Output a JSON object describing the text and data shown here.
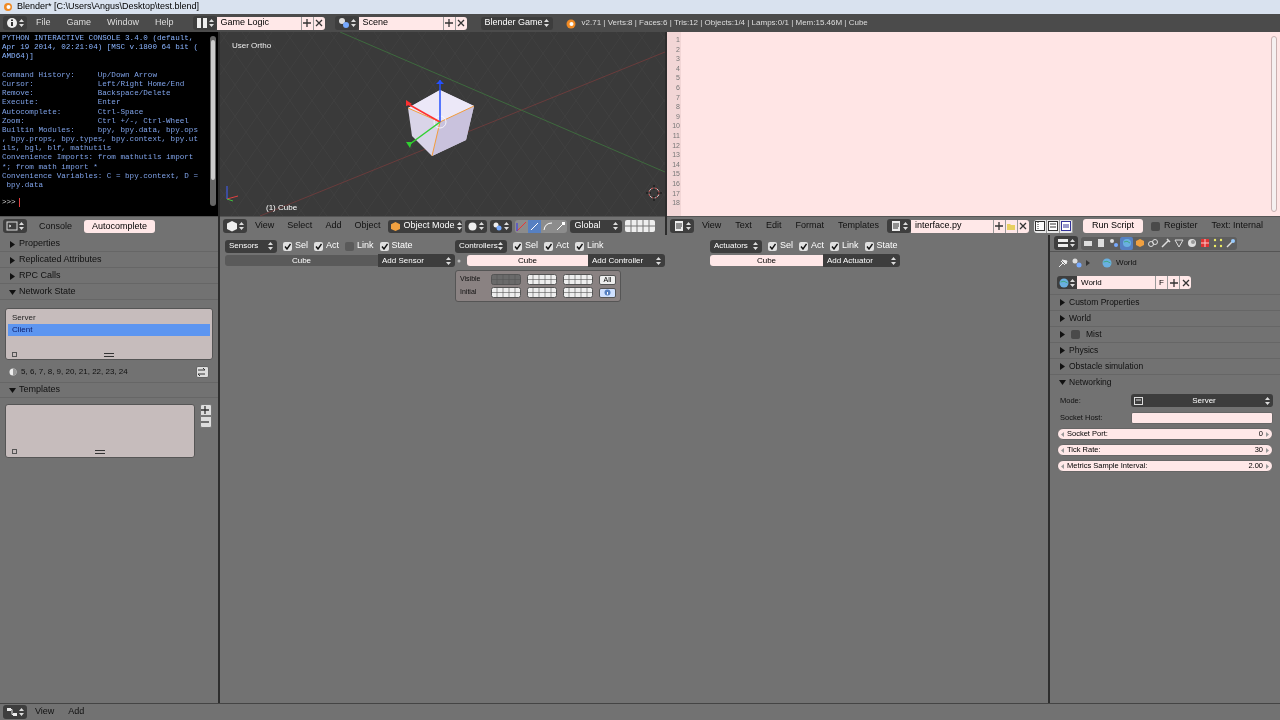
{
  "window": {
    "title": "Blender* [C:\\Users\\Angus\\Desktop\\test.blend]"
  },
  "menu_bar": {
    "menus": [
      "File",
      "Game",
      "Window",
      "Help"
    ],
    "screen": "Game Logic",
    "scene": "Scene",
    "engine": "Blender Game",
    "stats": "v2.71 | Verts:8 | Faces:6 | Tris:12 | Objects:1/4 | Lamps:0/1 | Mem:15.46M | Cube"
  },
  "console": {
    "lines": [
      {
        "kind": "banner",
        "text": "PYTHON INTERACTIVE CONSOLE 3.4.0 (default,"
      },
      {
        "kind": "banner",
        "text": "Apr 19 2014, 02:21:04) [MSC v.1800 64 bit ("
      },
      {
        "kind": "banner",
        "text": "AMD64)]"
      },
      {
        "kind": "info",
        "text": "Command History:     Up/Down Arrow"
      },
      {
        "kind": "info",
        "text": "Cursor:              Left/Right Home/End"
      },
      {
        "kind": "info",
        "text": "Remove:              Backspace/Delete"
      },
      {
        "kind": "info",
        "text": "Execute:             Enter"
      },
      {
        "kind": "info",
        "text": "Autocomplete:        Ctrl-Space"
      },
      {
        "kind": "info",
        "text": "Zoom:                Ctrl +/-, Ctrl-Wheel"
      },
      {
        "kind": "info",
        "text": "Builtin Modules:     bpy, bpy.data, bpy.ops"
      },
      {
        "kind": "info",
        "text": ", bpy.props, bpy.types, bpy.context, bpy.ut"
      },
      {
        "kind": "info",
        "text": "ils, bgl, blf, mathutils"
      },
      {
        "kind": "info",
        "text": "Convenience Imports: from mathutils import"
      },
      {
        "kind": "info",
        "text": "*; from math import *"
      },
      {
        "kind": "info",
        "text": "Convenience Variables: C = bpy.context, D ="
      },
      {
        "kind": "info",
        "text": " bpy.data"
      }
    ],
    "prompt": ">>>",
    "tabs": [
      {
        "label": "Console",
        "selected": false
      },
      {
        "label": "Autocomplete",
        "selected": true
      }
    ]
  },
  "viewport": {
    "view_name": "User Ortho",
    "object_label": "(1) Cube",
    "menus": [
      "View",
      "Select",
      "Add",
      "Object"
    ],
    "mode": "Object Mode",
    "orientation": "Global"
  },
  "text_editor": {
    "line_numbers": [
      "1",
      "2",
      "3",
      "4",
      "5",
      "6",
      "7",
      "8",
      "9",
      "10",
      "11",
      "12",
      "13",
      "14",
      "15",
      "16",
      "17",
      "18"
    ],
    "menus": [
      "View",
      "Text",
      "Edit",
      "Format",
      "Templates"
    ],
    "file": "interface.py",
    "run_button": "Run Script",
    "register": {
      "label": "Register",
      "checked": false
    },
    "status": "Text: Internal"
  },
  "left_panel": {
    "panels": [
      {
        "title": "Properties",
        "expanded": false
      },
      {
        "title": "Replicated Attributes",
        "expanded": false
      },
      {
        "title": "RPC Calls",
        "expanded": false
      },
      {
        "kind": "network",
        "title": "Network State",
        "expanded": true,
        "list": [
          {
            "label": "Server",
            "selected": false
          },
          {
            "label": "Client",
            "selected": true
          }
        ],
        "layers": "5, 6, 7, 8, 9, 20, 21, 22, 23, 24"
      },
      {
        "kind": "templates",
        "title": "Templates",
        "expanded": true
      }
    ]
  },
  "logic": {
    "columns": [
      {
        "kind": "sensors",
        "menu": "Sensors",
        "filters": [
          {
            "label": "Sel",
            "checked": true
          },
          {
            "label": "Act",
            "checked": true
          },
          {
            "label": "Link",
            "checked": false
          },
          {
            "label": "State",
            "checked": true
          }
        ],
        "object": "Cube",
        "add": "Add Sensor"
      },
      {
        "kind": "controllers",
        "menu": "Controllers",
        "filters": [
          {
            "label": "Sel",
            "checked": true
          },
          {
            "label": "Act",
            "checked": true
          },
          {
            "label": "Link",
            "checked": true
          }
        ],
        "object": "Cube",
        "add": "Add Controller",
        "states": {
          "visible": "Visible",
          "initial": "Initial",
          "all": "All"
        }
      },
      {
        "kind": "actuators",
        "menu": "Actuators",
        "filters": [
          {
            "label": "Sel",
            "checked": true
          },
          {
            "label": "Act",
            "checked": true
          },
          {
            "label": "Link",
            "checked": true
          },
          {
            "label": "State",
            "checked": true
          }
        ],
        "object": "Cube",
        "add": "Add Actuator"
      }
    ]
  },
  "properties": {
    "context_tabs": [
      {
        "selected": false
      },
      {
        "selected": false
      },
      {
        "selected": false
      },
      {
        "selected": true
      },
      {
        "selected": false
      },
      {
        "selected": false
      },
      {
        "selected": false
      },
      {
        "selected": false
      },
      {
        "selected": false
      },
      {
        "selected": false
      },
      {
        "selected": false
      },
      {
        "selected": false
      }
    ],
    "path": "World",
    "datablock": "World",
    "fake_user": "F",
    "panels": [
      {
        "title": "Custom Properties",
        "expanded": false
      },
      {
        "title": "World",
        "expanded": false
      },
      {
        "kind": "toggle",
        "title": "Mist",
        "expanded": false,
        "checked": false
      },
      {
        "title": "Physics",
        "expanded": false
      },
      {
        "title": "Obstacle simulation",
        "expanded": false
      },
      {
        "title": "Networking",
        "expanded": true
      }
    ],
    "networking": {
      "mode_label": "Mode:",
      "mode": "Server",
      "host_label": "Socket Host:",
      "sliders": [
        {
          "label": "Socket Port:",
          "value": "0"
        },
        {
          "label": "Tick Rate:",
          "value": "30"
        },
        {
          "label": "Metrics Sample Interval:",
          "value": "2.00"
        }
      ]
    }
  },
  "bottom_bar": {
    "menus": [
      "View",
      "Add"
    ]
  }
}
